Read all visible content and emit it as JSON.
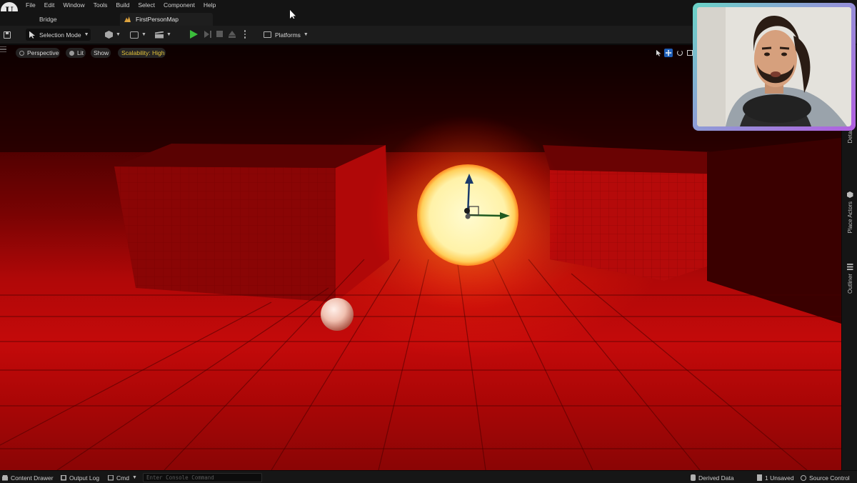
{
  "menu": {
    "items": [
      "File",
      "Edit",
      "Window",
      "Tools",
      "Build",
      "Select",
      "Component",
      "Help"
    ]
  },
  "tabs": {
    "bridge": "Bridge",
    "map": "FirstPersonMap"
  },
  "toolbar": {
    "selection_mode": "Selection Mode",
    "platforms": "Platforms"
  },
  "viewport": {
    "perspective": "Perspective",
    "lit": "Lit",
    "show": "Show",
    "scalability": "Scalability: High"
  },
  "side_panel": {
    "details": "Details",
    "place_actors": "Place Actors",
    "outliner": "Outliner"
  },
  "status_bar": {
    "content_drawer": "Content Drawer",
    "output_log": "Output Log",
    "cmd": "Cmd",
    "console_placeholder": "Enter Console Command",
    "derived_data": "Derived Data",
    "unsaved": "1 Unsaved",
    "source_control": "Source Control"
  },
  "colors": {
    "accent_play": "#3bbd3b",
    "scalability_text": "#e4c33a",
    "viewport_red": "#c40a0a",
    "sphere_glow": "#fff5b0",
    "webcam_border_start": "#6ad3c6",
    "webcam_border_end": "#b15fe0"
  },
  "icons": [
    "unreal-logo-icon",
    "save-icon",
    "selection-arrow-icon",
    "add-actor-icon",
    "blueprint-icon",
    "cinematics-icon",
    "play-icon",
    "step-icon",
    "stop-icon",
    "eject-icon",
    "more-icon",
    "platforms-icon",
    "hamburger-icon",
    "select-tool-icon",
    "move-tool-icon",
    "rotate-tool-icon",
    "scale-tool-icon",
    "place-actors-icon",
    "outliner-icon",
    "content-drawer-icon",
    "output-log-icon",
    "cmd-icon",
    "derived-data-icon",
    "unsaved-icon",
    "source-control-icon"
  ]
}
